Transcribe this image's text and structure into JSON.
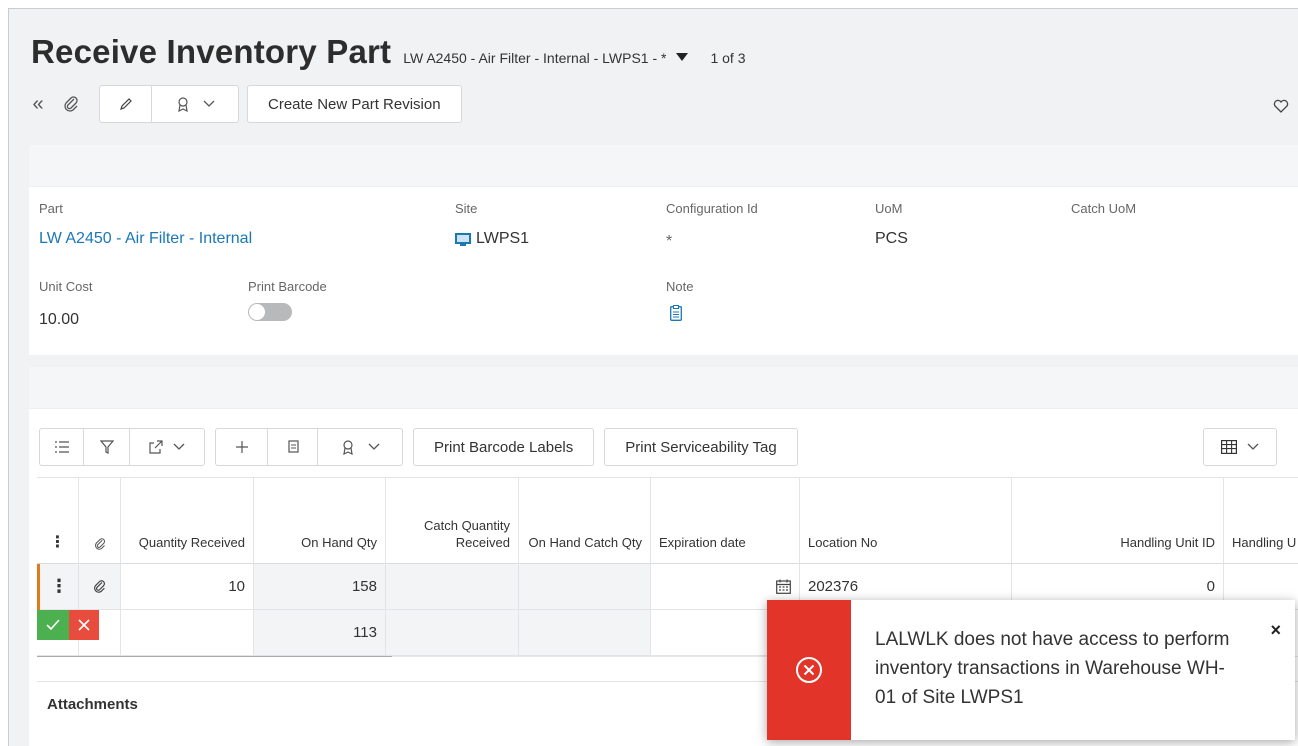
{
  "header": {
    "title": "Receive Inventory Part",
    "record_desc": "LW A2450 - Air Filter - Internal - LWPS1 - *",
    "record_count": "1 of 3"
  },
  "toolbar": {
    "create_revision_label": "Create New Part Revision"
  },
  "part_card": {
    "part_label": "Part",
    "part_value": "LW A2450 - Air Filter - Internal",
    "site_label": "Site",
    "site_value": "LWPS1",
    "config_label": "Configuration Id",
    "config_value": "*",
    "uom_label": "UoM",
    "uom_value": "PCS",
    "catch_uom_label": "Catch UoM",
    "unit_cost_label": "Unit Cost",
    "unit_cost_value": "10.00",
    "print_barcode_label": "Print Barcode",
    "print_barcode_on": false,
    "note_label": "Note"
  },
  "grid_toolbar": {
    "print_barcode_labels": "Print Barcode Labels",
    "print_serviceability_tag": "Print Serviceability Tag"
  },
  "grid": {
    "columns": {
      "qty_received": "Quantity Received",
      "on_hand_qty": "On Hand Qty",
      "catch_qty_received": "Catch Quantity Received",
      "on_hand_catch_qty": "On Hand Catch Qty",
      "expiration_date": "Expiration date",
      "location_no": "Location No",
      "handling_unit_id": "Handling Unit ID",
      "handling_unit_type": "Handling U"
    },
    "rows": [
      {
        "qty_received": "10",
        "on_hand_qty": "158",
        "catch_qty_received": "",
        "on_hand_catch_qty": "",
        "expiration_date": "",
        "location_no": "202376",
        "handling_unit_id": "0"
      },
      {
        "qty_received": "",
        "on_hand_qty": "113",
        "catch_qty_received": "",
        "on_hand_catch_qty": "",
        "expiration_date": "",
        "location_no": "",
        "handling_unit_id": ""
      }
    ]
  },
  "attachments_label": "Attachments",
  "toast": {
    "message": "LALWLK does not have access to perform inventory transactions in Warehouse WH-01 of Site LWPS1",
    "close_glyph": "×",
    "color": "#e3342a"
  },
  "colors": {
    "link": "#1a78b4",
    "row_marker": "#e07a1a",
    "confirm": "#4caf50",
    "cancel": "#e84c3d"
  }
}
